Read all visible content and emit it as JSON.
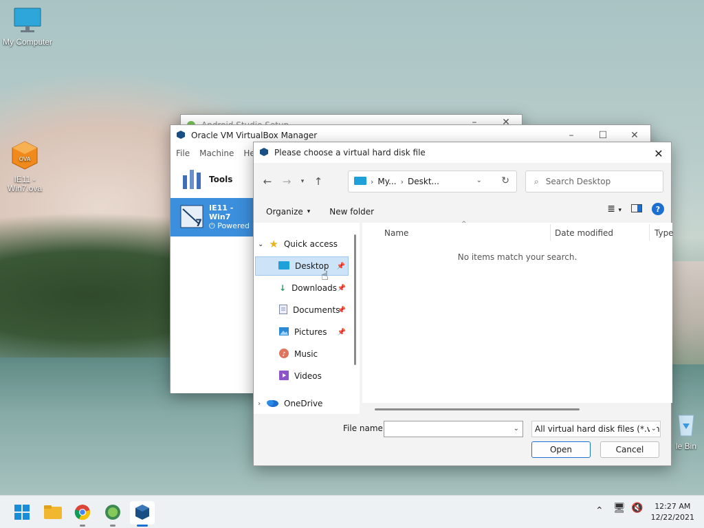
{
  "desktop": {
    "icons": [
      {
        "label": "My Computer",
        "icon": "monitor-icon"
      },
      {
        "label_line1": "IE11 -",
        "label_line2": "Win7.ova",
        "icon": "ova-file-icon"
      },
      {
        "label": "le Bin",
        "icon": "recycle-bin-icon"
      }
    ]
  },
  "android_setup": {
    "title": "Android Studio Setup"
  },
  "vbox_manager": {
    "title": "Oracle VM VirtualBox Manager",
    "menu": [
      "File",
      "Machine",
      "He"
    ],
    "tools_label": "Tools",
    "vm": {
      "name": "IE11 - Win7",
      "state": "Powered",
      "badge": "7"
    }
  },
  "dialog": {
    "title": "Please choose a virtual hard disk file",
    "breadcrumb": [
      "My...",
      "Deskt..."
    ],
    "search_placeholder": "Search Desktop",
    "organize_label": "Organize",
    "new_folder_label": "New folder",
    "nav": {
      "quick_access": "Quick access",
      "items": [
        {
          "label": "Desktop",
          "icon": "desktop-folder-icon",
          "pinned": true,
          "selected": true
        },
        {
          "label": "Downloads",
          "icon": "download-icon",
          "pinned": true
        },
        {
          "label": "Documents",
          "icon": "documents-icon",
          "pinned": true
        },
        {
          "label": "Pictures",
          "icon": "pictures-icon",
          "pinned": true
        },
        {
          "label": "Music",
          "icon": "music-icon",
          "pinned": false
        },
        {
          "label": "Videos",
          "icon": "videos-icon",
          "pinned": false
        }
      ],
      "onedrive": "OneDrive"
    },
    "columns": [
      "Name",
      "Date modified",
      "Type"
    ],
    "empty_message": "No items match your search.",
    "file_name_label": "File name:",
    "file_name_value": "",
    "file_type_value": "All virtual hard disk files (*.vmd",
    "open_label": "Open",
    "cancel_label": "Cancel"
  },
  "taskbar": {
    "apps": [
      "start-icon",
      "file-explorer-icon",
      "chrome-icon",
      "android-studio-icon",
      "virtualbox-icon"
    ],
    "active_app": "virtualbox-icon",
    "clock_time": "12:27 AM",
    "clock_date": "12/22/2021"
  },
  "colors": {
    "accent": "#1b6fd1",
    "selection": "#cde3f8",
    "vm_selected": "#3c8fdc"
  }
}
